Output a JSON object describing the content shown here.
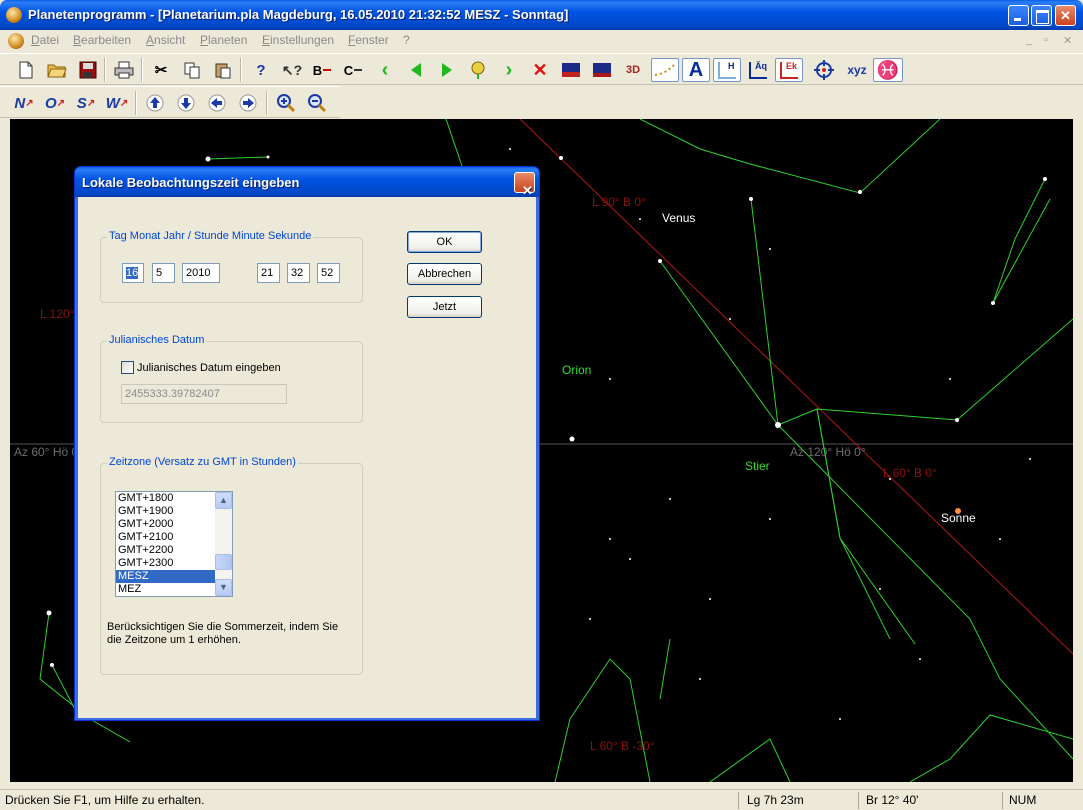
{
  "window": {
    "title": "Planetenprogramm - [Planetarium.pla  Magdeburg, 16.05.2010 21:32:52 MESZ - Sonntag]"
  },
  "menu": [
    "Datei",
    "Bearbeiten",
    "Ansicht",
    "Planeten",
    "Einstellungen",
    "Fenster",
    "?"
  ],
  "toolbar2_labels": [
    "N",
    "O",
    "S",
    "W"
  ],
  "toolbar1_text": {
    "b_icon": "B",
    "c_icon": "C",
    "three_d": "3D",
    "a_icon": "A",
    "h_icon": "H",
    "aq_icon": "Äq",
    "ek_icon": "Ek",
    "xyz": "xyz"
  },
  "sky": {
    "labels": [
      {
        "text": "Venus",
        "color": "#ffffff"
      },
      {
        "text": "Orion",
        "color": "#33dd33"
      },
      {
        "text": "Stier",
        "color": "#33dd33"
      },
      {
        "text": "Sonne",
        "color": "#ffffff"
      },
      {
        "text": "L 90°  B 0°",
        "color": "#8b1010"
      },
      {
        "text": "L 120°",
        "color": "#8b1010"
      },
      {
        "text": "Az 60°  Hö 0°",
        "color": "#6e6e6e"
      },
      {
        "text": "Az 120°  Hö 0°",
        "color": "#6e6e6e"
      },
      {
        "text": "L 60°  B 0°",
        "color": "#8b1010"
      },
      {
        "text": "L 60°  B -30°",
        "color": "#8b1010"
      }
    ]
  },
  "dialog": {
    "title": "Lokale Beobachtungszeit eingeben",
    "group_datetime": "Tag Monat Jahr   /   Stunde Minute Sekunde",
    "day": "16",
    "month": "5",
    "year": "2010",
    "hour": "21",
    "minute": "32",
    "second": "52",
    "ok": "OK",
    "cancel": "Abbrechen",
    "now": "Jetzt",
    "group_julian": "Julianisches Datum",
    "julian_checkbox": "Julianisches Datum eingeben",
    "julian_value": "2455333.39782407",
    "group_timezone": "Zeitzone (Versatz zu GMT in Stunden)",
    "timezones": [
      "GMT+1800",
      "GMT+1900",
      "GMT+2000",
      "GMT+2100",
      "GMT+2200",
      "GMT+2300",
      "MESZ",
      "MEZ"
    ],
    "selected_timezone": "MESZ",
    "hint_line1": "Berücksichtigen Sie die Sommerzeit, indem Sie",
    "hint_line2": "die Zeitzone um 1 erhöhen."
  },
  "status": {
    "help": "Drücken Sie F1, um Hilfe zu erhalten.",
    "lg": "Lg   7h 23m",
    "br": "Br  12° 40'",
    "num": "NUM"
  }
}
